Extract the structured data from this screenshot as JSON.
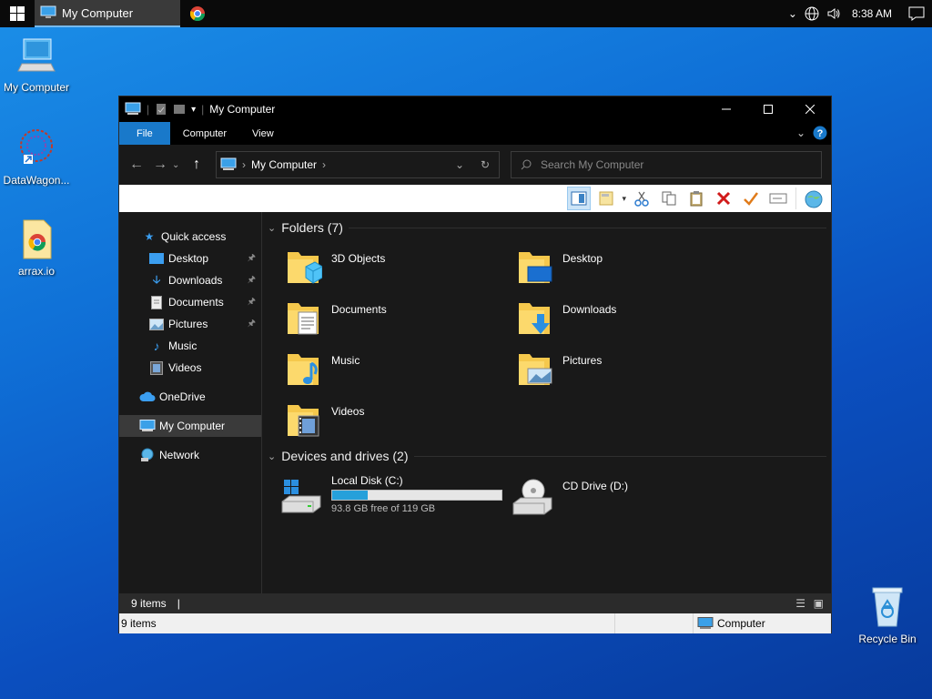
{
  "taskbar": {
    "active_task": "My Computer",
    "clock": "8:38 AM"
  },
  "desktop": {
    "icons": [
      {
        "label": "My Computer"
      },
      {
        "label": "DataWagon..."
      },
      {
        "label": "arrax.io"
      },
      {
        "label": "Recycle Bin"
      }
    ]
  },
  "window": {
    "title": "My Computer",
    "ribbon_tabs": [
      "File",
      "Computer",
      "View"
    ],
    "address_path": "My Computer",
    "search_placeholder": "Search My Computer",
    "nav": {
      "quick_access": "Quick access",
      "items": [
        "Desktop",
        "Downloads",
        "Documents",
        "Pictures",
        "Music",
        "Videos"
      ],
      "onedrive": "OneDrive",
      "my_computer": "My Computer",
      "network": "Network"
    },
    "folders_header": "Folders (7)",
    "folders": [
      "3D Objects",
      "Desktop",
      "Documents",
      "Downloads",
      "Music",
      "Pictures",
      "Videos"
    ],
    "devices_header": "Devices and drives (2)",
    "drives": [
      {
        "name": "Local Disk (C:)",
        "free_text": "93.8 GB free of 119 GB",
        "used_fraction": 0.21
      },
      {
        "name": "CD Drive (D:)"
      }
    ],
    "status_top": "9 items",
    "status_bottom_left": "9 items",
    "status_bottom_location": "Computer"
  },
  "colors": {
    "accent": "#1979ca",
    "folder_yellow": "#f5c84c",
    "drive_bar": "#26a0da"
  }
}
